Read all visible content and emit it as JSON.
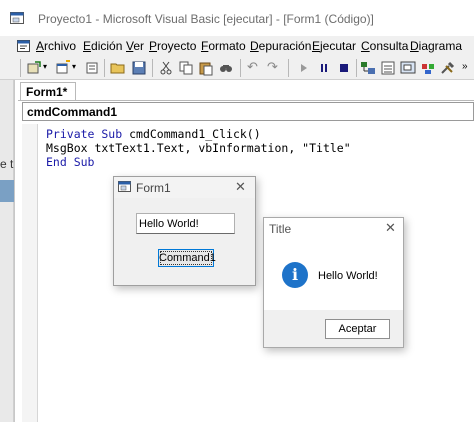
{
  "window": {
    "title": "Proyecto1 - Microsoft Visual Basic [ejecutar] - [Form1 (Código)]"
  },
  "menu": [
    {
      "u": "A",
      "rest": "rchivo"
    },
    {
      "u": "E",
      "rest": "dición"
    },
    {
      "u": "V",
      "rest": "er"
    },
    {
      "u": "P",
      "rest": "royecto"
    },
    {
      "u": "F",
      "rest": "ormato"
    },
    {
      "u": "D",
      "rest": "epuración"
    },
    {
      "u": "E",
      "rest": "jecutar"
    },
    {
      "u": "C",
      "rest": "onsulta"
    },
    {
      "u": "D",
      "rest": "iagrama"
    }
  ],
  "left_strip": {
    "text": "e t"
  },
  "code_window": {
    "tab": "Form1*",
    "object_combo": "cmdCommand1",
    "lines": [
      {
        "kw": "Private Sub",
        "rest": " cmdCommand1_Click()"
      },
      {
        "kw": "",
        "rest": "MsgBox txtText1.Text, vbInformation, \"Title\""
      },
      {
        "kw": "End Sub",
        "rest": ""
      }
    ]
  },
  "form1": {
    "title": "Form1",
    "textbox_value": "Hello World!",
    "button_label": "Command1",
    "close_glyph": "✕"
  },
  "msgbox": {
    "title": "Title",
    "message": "Hello World!",
    "ok_label": "Aceptar",
    "icon_glyph": "i",
    "close_glyph": "✕"
  },
  "colors": {
    "keyword": "#1a1aa8",
    "focus_border": "#0078d7",
    "info_icon": "#1e73c9"
  }
}
